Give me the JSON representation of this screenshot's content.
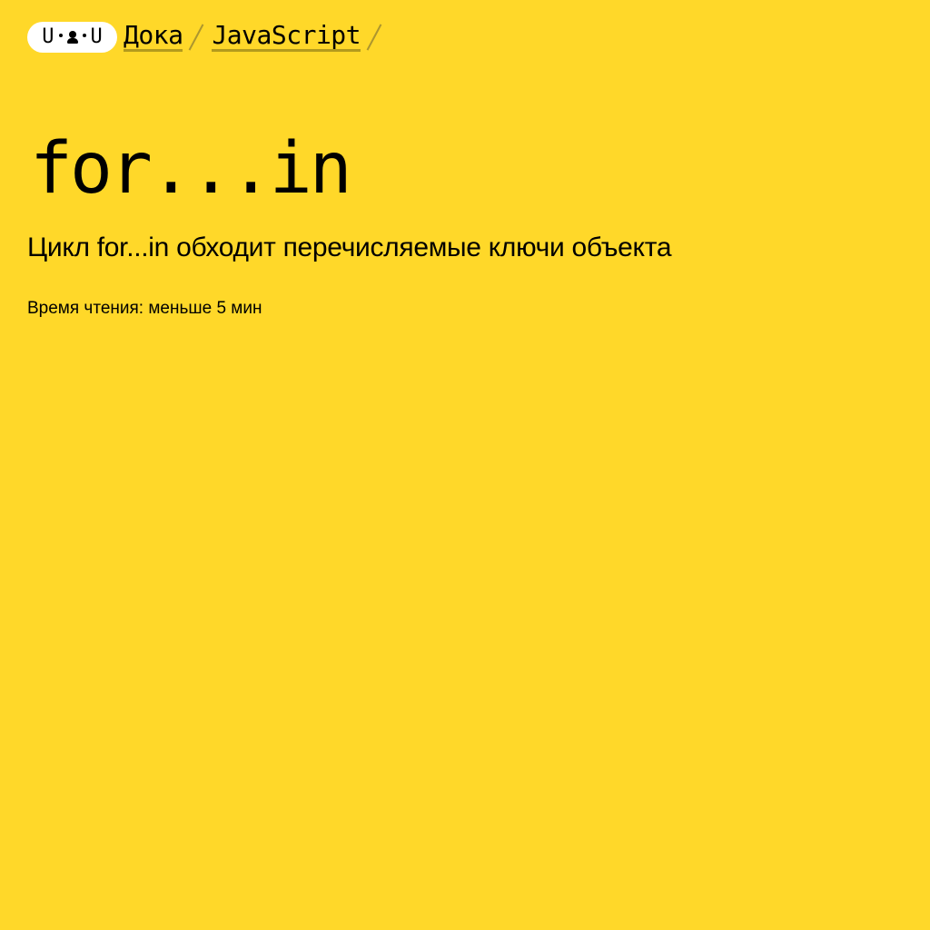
{
  "header": {
    "logo": {
      "left": "U",
      "right": "U",
      "icon": "doka-face-logo"
    },
    "breadcrumbs": [
      {
        "label": "Дока"
      },
      {
        "label": "JavaScript"
      }
    ],
    "separator_icon": "slash-separator-icon"
  },
  "article": {
    "title": "for...in",
    "lead": "Цикл for...in обходит перечисляемые ключи объекта",
    "reading_time": "Время чтения: меньше 5 мин"
  },
  "colors": {
    "background": "#ffd829",
    "text": "#000000",
    "logo_background": "#ffffff"
  }
}
